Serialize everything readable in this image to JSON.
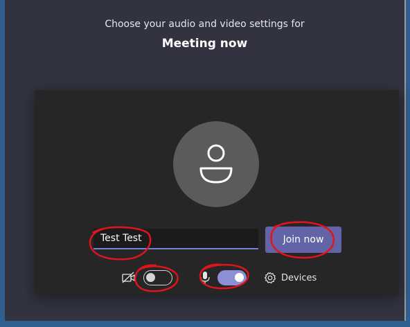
{
  "header": {
    "subtitle": "Choose your audio and video settings for",
    "meeting_title": "Meeting now"
  },
  "prejoin": {
    "name_input_value": "Test Test",
    "join_button_label": "Join now",
    "camera_on": false,
    "mic_on": true,
    "devices_label": "Devices"
  },
  "icons": {
    "avatar": "person-icon",
    "camera": "camera-off-icon",
    "mic": "microphone-icon",
    "devices": "gear-icon"
  },
  "colors": {
    "background": "#33333f",
    "card": "#262626",
    "accent": "#6264a7",
    "toggle_on": "#8b8fd6",
    "annotation": "#e0141e"
  }
}
